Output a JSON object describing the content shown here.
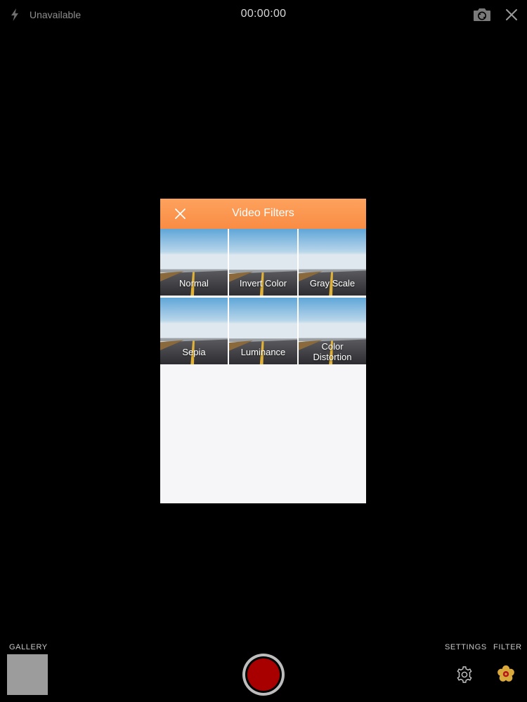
{
  "top_bar": {
    "flash_status": "Unavailable",
    "timer": "00:00:00",
    "switch_camera_icon": "camera-switch-icon",
    "close_icon": "close-icon"
  },
  "filter_modal": {
    "title": "Video Filters",
    "accent_color": "#fa9a52",
    "close_icon": "close-icon",
    "filters": [
      {
        "label": "Normal",
        "style": "normal"
      },
      {
        "label": "Invert Color",
        "style": "normal"
      },
      {
        "label": "Gray Scale",
        "style": "normal"
      },
      {
        "label": "Sepia",
        "style": "normal"
      },
      {
        "label": "Luminance",
        "style": "normal"
      },
      {
        "label": "Color Distortion",
        "style": "normal"
      }
    ]
  },
  "bottom_bar": {
    "gallery_label": "GALLERY",
    "settings_label": "SETTINGS",
    "filter_label": "FILTER",
    "record_color": "#a80000",
    "settings_icon": "gear-icon",
    "filter_icon": "flower-icon"
  }
}
